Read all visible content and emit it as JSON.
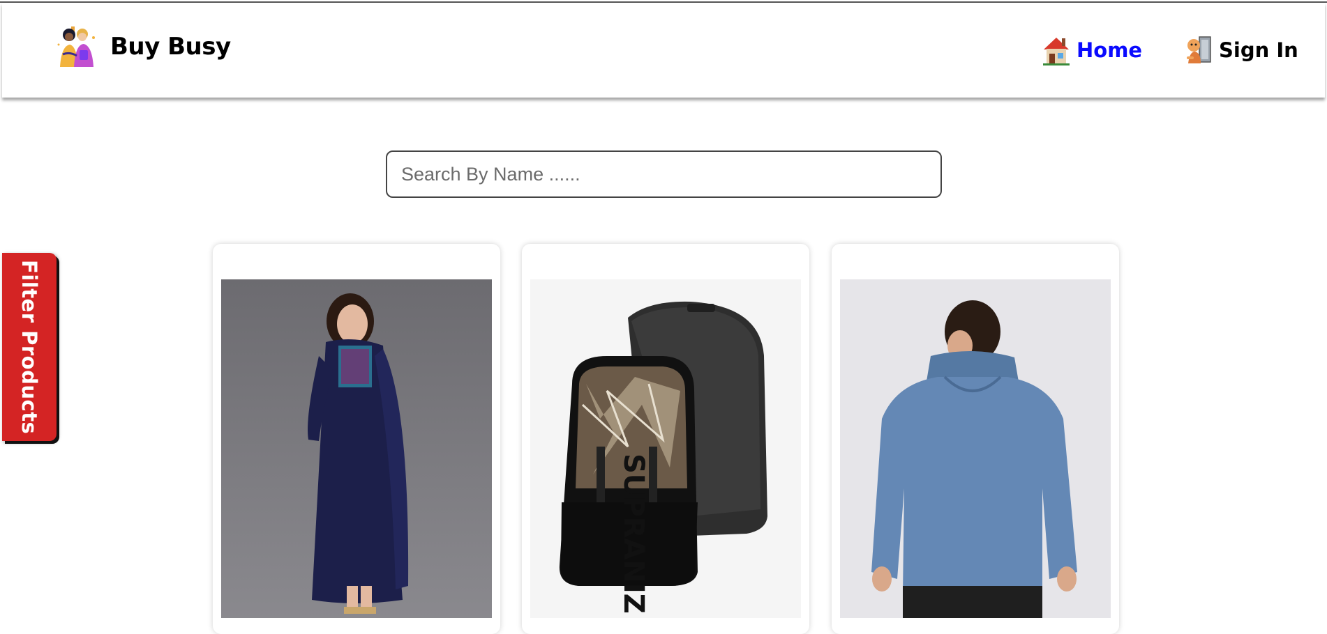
{
  "brand": {
    "name": "Buy Busy",
    "logo_icon": "shoppers-logo-icon"
  },
  "nav": {
    "home_label": "Home",
    "home_icon": "house-icon",
    "signin_label": "Sign In",
    "signin_icon": "sign-in-door-icon",
    "active_color": "#0a0aff"
  },
  "search": {
    "placeholder": "Search By Name ......",
    "value": ""
  },
  "filter": {
    "label": "Filter Products",
    "color": "#d42424"
  },
  "products": [
    {
      "image": "woman-in-navy-kurta-image"
    },
    {
      "image": "camouflage-backpack-image"
    },
    {
      "image": "man-in-blue-hoodie-image"
    }
  ]
}
